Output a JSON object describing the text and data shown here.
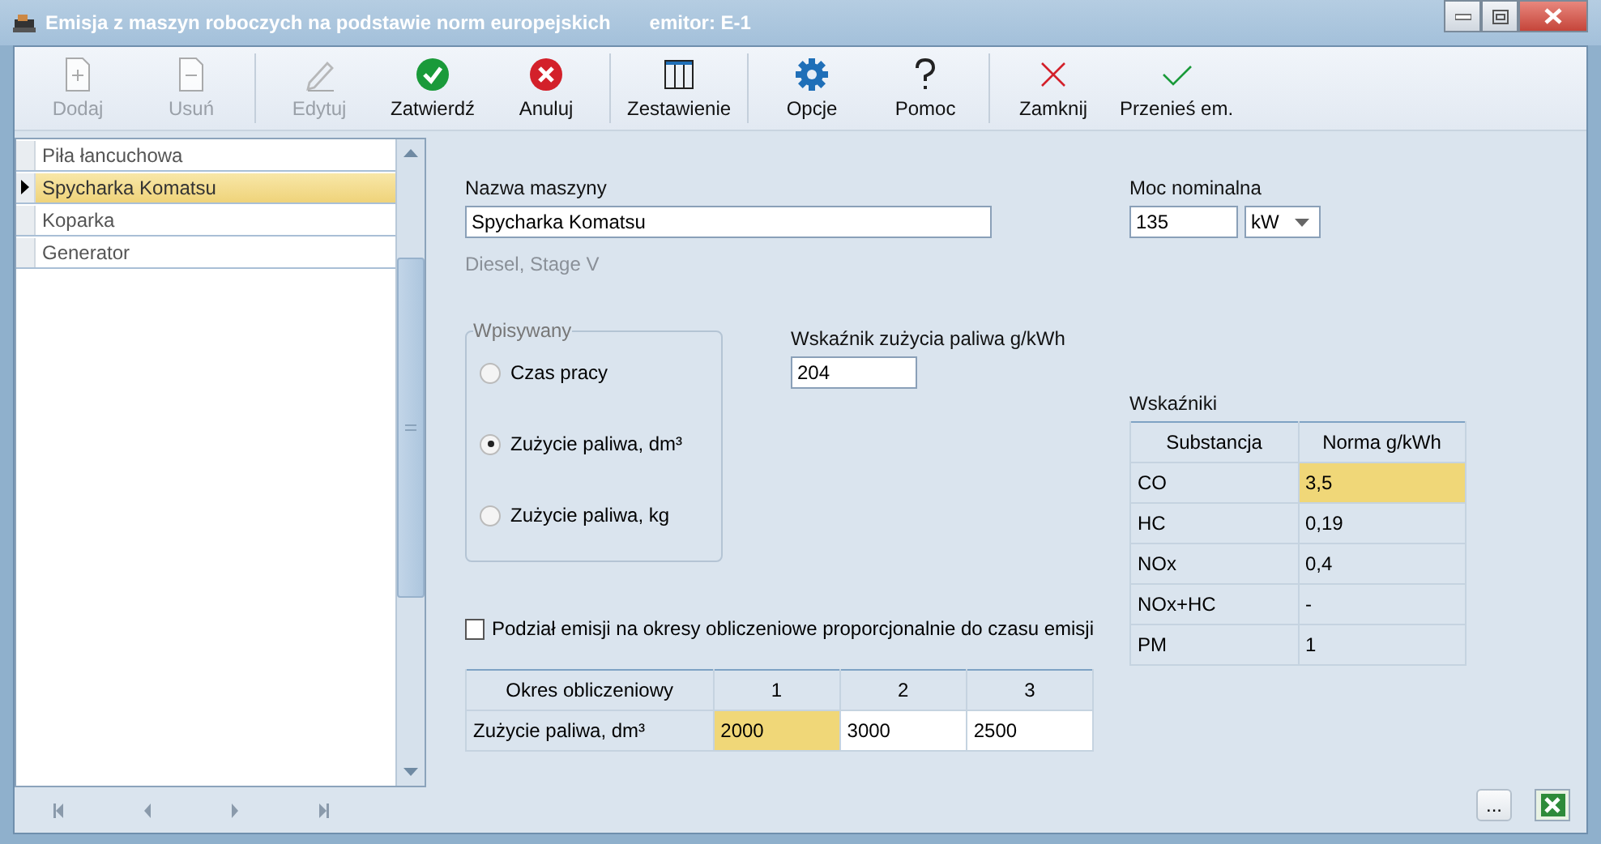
{
  "window": {
    "title": "Emisja z maszyn roboczych na podstawie norm europejskich",
    "subtitle": "emitor: E-1"
  },
  "toolbar": [
    {
      "buttons": [
        {
          "label": "Dodaj",
          "kind": "add",
          "disabled": true
        },
        {
          "label": "Usuń",
          "kind": "remove",
          "disabled": true
        }
      ]
    },
    {
      "buttons": [
        {
          "label": "Edytuj",
          "kind": "edit",
          "disabled": true
        },
        {
          "label": "Zatwierdź",
          "kind": "confirm",
          "disabled": false
        },
        {
          "label": "Anuluj",
          "kind": "cancel",
          "disabled": false
        }
      ]
    },
    {
      "buttons": [
        {
          "label": "Zestawienie",
          "kind": "columns",
          "disabled": false
        }
      ]
    },
    {
      "buttons": [
        {
          "label": "Opcje",
          "kind": "gear",
          "disabled": false
        },
        {
          "label": "Pomoc",
          "kind": "help",
          "disabled": false
        }
      ]
    },
    {
      "buttons": [
        {
          "label": "Zamknij",
          "kind": "close",
          "disabled": false
        },
        {
          "label": "Przenieś em.",
          "kind": "check",
          "disabled": false
        }
      ]
    }
  ],
  "machines": [
    {
      "name": "Piła łancuchowa",
      "selected": false
    },
    {
      "name": "Spycharka Komatsu",
      "selected": true
    },
    {
      "name": "Koparka",
      "selected": false
    },
    {
      "name": "Generator",
      "selected": false
    }
  ],
  "form": {
    "name_label": "Nazwa maszyny",
    "name_value": "Spycharka Komatsu",
    "engine_info": "Diesel, Stage V",
    "power_label": "Moc nominalna",
    "power_value": "135",
    "power_unit": "kW",
    "input_group": {
      "title": "Wpisywany",
      "options": [
        {
          "label": "Czas pracy",
          "selected": false
        },
        {
          "label": "Zużycie paliwa, dm³",
          "selected": true
        },
        {
          "label": "Zużycie paliwa, kg",
          "selected": false
        }
      ]
    },
    "fuel_index_label": "Wskaźnik zużycia paliwa g/kWh",
    "fuel_index_value": "204",
    "split_checkbox": {
      "label": "Podział emisji na okresy obliczeniowe proporcjonalnie do czasu emisji",
      "checked": false
    }
  },
  "indicators": {
    "title": "Wskaźniki",
    "columns": [
      "Substancja",
      "Norma g/kWh"
    ],
    "rows": [
      {
        "substance": "CO",
        "norm": "3,5",
        "selected": true
      },
      {
        "substance": "HC",
        "norm": "0,19",
        "selected": false
      },
      {
        "substance": "NOx",
        "norm": "0,4",
        "selected": false
      },
      {
        "substance": "NOx+HC",
        "norm": "-",
        "selected": false
      },
      {
        "substance": "PM",
        "norm": "1",
        "selected": false
      }
    ]
  },
  "periods": {
    "columns": [
      "Okres obliczeniowy",
      "1",
      "2",
      "3"
    ],
    "row_label": "Zużycie paliwa, dm³",
    "values": [
      {
        "value": "2000",
        "selected": true
      },
      {
        "value": "3000",
        "selected": false
      },
      {
        "value": "2500",
        "selected": false
      }
    ]
  },
  "footer_buttons": [
    {
      "label": "...",
      "kind": "text"
    },
    {
      "kind": "excel"
    }
  ]
}
